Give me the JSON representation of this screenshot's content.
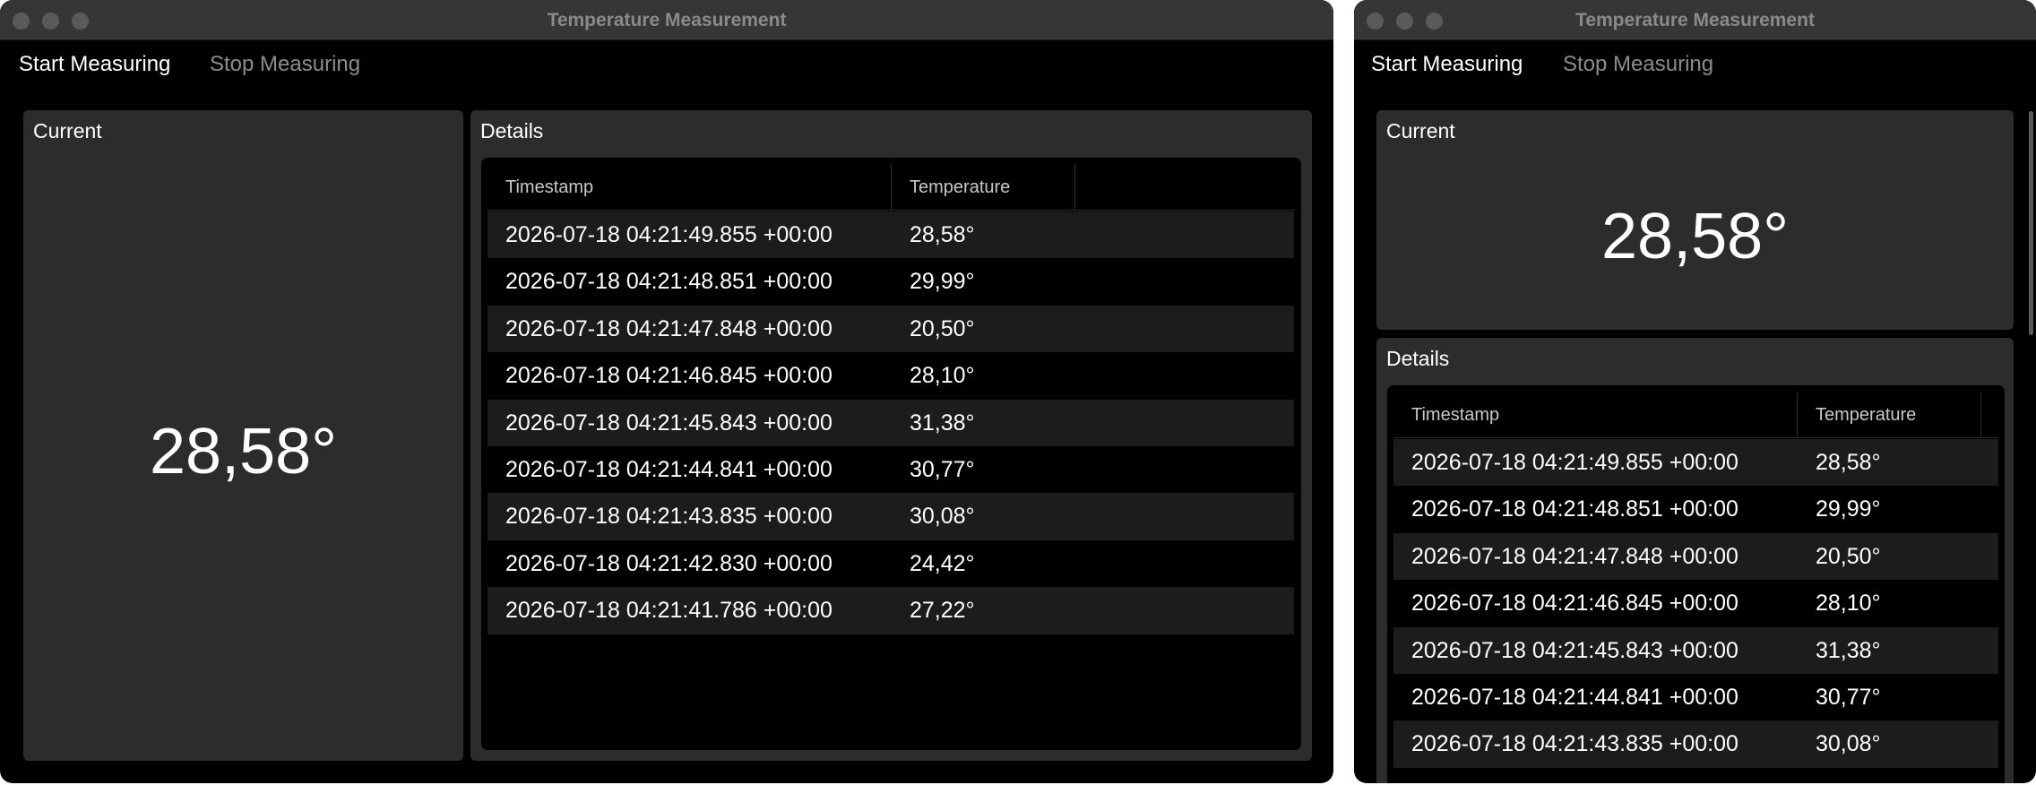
{
  "app": {
    "title": "Temperature Measurement"
  },
  "menu": {
    "start": "Start Measuring",
    "stop": "Stop Measuring"
  },
  "current": {
    "title": "Current",
    "value": "28,58°"
  },
  "details": {
    "title": "Details",
    "columns": [
      "Timestamp",
      "Temperature"
    ],
    "rows": [
      [
        "2026-07-18 04:21:49.855 +00:00",
        "28,58°"
      ],
      [
        "2026-07-18 04:21:48.851 +00:00",
        "29,99°"
      ],
      [
        "2026-07-18 04:21:47.848 +00:00",
        "20,50°"
      ],
      [
        "2026-07-18 04:21:46.845 +00:00",
        "28,10°"
      ],
      [
        "2026-07-18 04:21:45.843 +00:00",
        "31,38°"
      ],
      [
        "2026-07-18 04:21:44.841 +00:00",
        "30,77°"
      ],
      [
        "2026-07-18 04:21:43.835 +00:00",
        "30,08°"
      ],
      [
        "2026-07-18 04:21:42.830 +00:00",
        "24,42°"
      ],
      [
        "2026-07-18 04:21:41.786 +00:00",
        "27,22°"
      ]
    ],
    "narrow_visible_rows": 7
  },
  "colors": {
    "window_bg": "#000000",
    "titlebar": "#363636",
    "panel": "#2c2c2c",
    "row_alt": "#1c1c1c",
    "text": "#ffffff",
    "text_dim": "#8c8c8c"
  }
}
